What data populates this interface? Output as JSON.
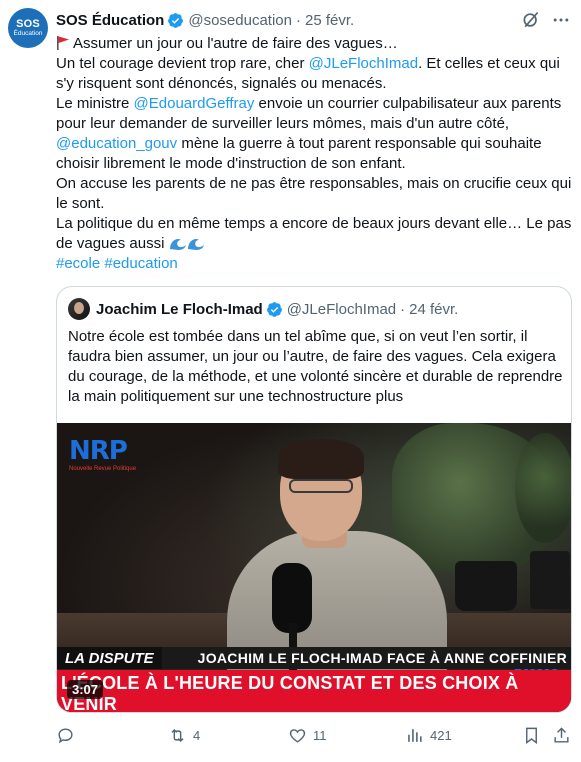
{
  "tweet": {
    "author_name": "SOS Éducation",
    "handle": "@soseducation",
    "separator": "·",
    "date": "25 févr.",
    "avatar_line1": "SOS",
    "avatar_line2": "Éducation",
    "line1": "Assumer un jour ou l'autre de faire des vagues…",
    "line2_a": "Un tel courage devient trop rare, cher ",
    "line2_mention": "@JLeFlochImad",
    "line2_b": ". Et celles et ceux qui s'y risquent sont dénoncés, signalés ou menacés.",
    "line3_a": "Le ministre ",
    "line3_mention": "@EdouardGeffray",
    "line3_b": " envoie un courrier culpabilisateur aux parents pour leur demander de surveiller leurs mômes, mais d'un autre côté, ",
    "line3_mention2": "@education_gouv",
    "line3_c": " mène la guerre à tout parent responsable qui souhaite choisir librement le mode d'instruction de son enfant.",
    "line4": "On accuse les parents de ne pas être responsables, mais on crucifie ceux qui le sont.",
    "line5": "La politique du en même temps a encore de beaux jours devant elle… Le pas de vagues aussi",
    "hashtags": "#ecole #education",
    "colors": {
      "link": "#1d9bf0",
      "verified": "#1d9bf0",
      "muted": "#536471"
    }
  },
  "quote": {
    "author_name": "Joachim Le Floch-Imad",
    "handle": "@JLeFlochImad",
    "separator": "·",
    "date": "24 févr.",
    "text": "Notre école est tombée dans un tel abîme que, si on veut l’en sortir, il faudra bien assumer, un jour ou l’autre, de faire des vagues. Cela exigera du courage, de la méthode, et une volonté sincère et durable de reprendre la main politiquement sur une technostructure plus",
    "video": {
      "logo_text": "NRP",
      "logo_sub": "Nouvelle Revue Politique",
      "band_left": "LA DISPUTE",
      "band_right": "JOACHIM LE FLOCH-IMAD FACE À ANNE COFFINIER",
      "headline": "L'ÉCOLE À L'HEURE DU CONSTAT ET DES CHOIX À VENIR",
      "duration": "3:07"
    }
  },
  "actions": {
    "retweets": "4",
    "likes": "11",
    "views": "421"
  }
}
